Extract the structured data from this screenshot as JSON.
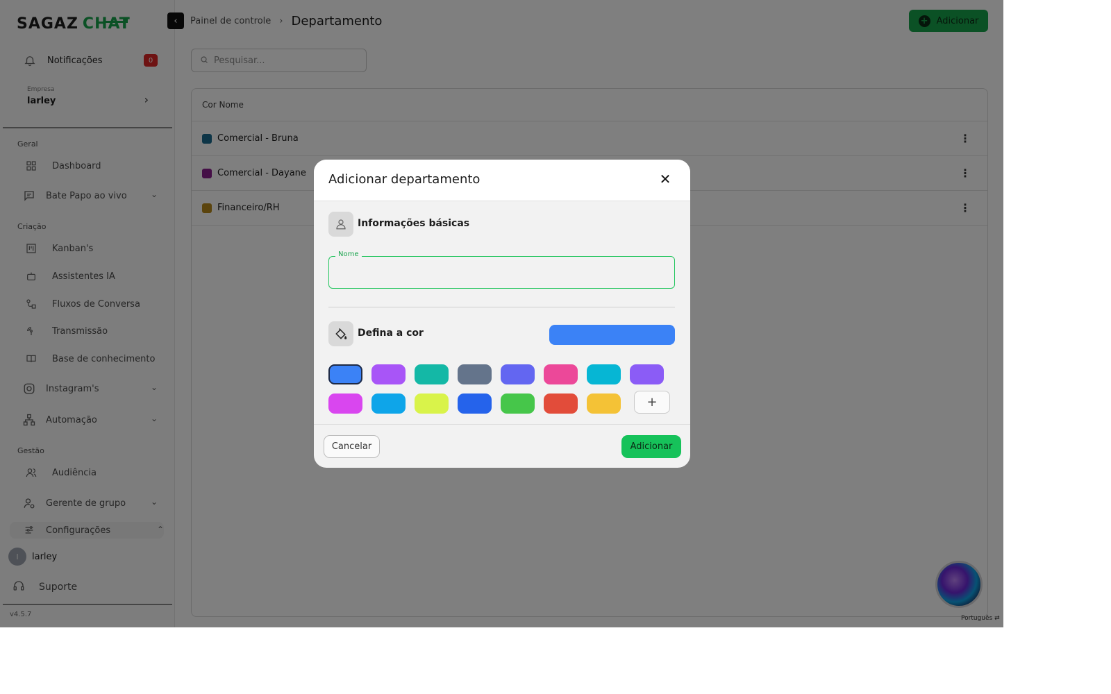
{
  "logo": {
    "part1": "SAGAZ",
    "part2": "CHAT"
  },
  "notifications": {
    "label": "Notificações",
    "count": "0"
  },
  "company": {
    "caption": "Empresa",
    "name": "larley"
  },
  "sidebar": {
    "sections": {
      "geral": "Geral",
      "criacao": "Criação",
      "gestao": "Gestão"
    },
    "items": {
      "dashboard": "Dashboard",
      "bate_papo": "Bate Papo ao vivo",
      "kanban": "Kanban's",
      "assistentes": "Assistentes IA",
      "fluxos": "Fluxos de Conversa",
      "transmissao": "Transmissão",
      "base": "Base de conhecimento",
      "instagram": "Instagram's",
      "automacao": "Automação",
      "audiencia": "Audiência",
      "gerente": "Gerente de grupo",
      "configuracoes": "Configurações"
    },
    "user": {
      "initial": "l",
      "name": "larley"
    },
    "support": "Suporte",
    "version": "v4.5.7"
  },
  "breadcrumb": {
    "parent": "Painel de controle",
    "current": "Departamento"
  },
  "header": {
    "add_label": "Adicionar"
  },
  "search": {
    "placeholder": "Pesquisar..."
  },
  "table": {
    "header": "Cor Nome",
    "rows": [
      {
        "name": "Comercial - Bruna",
        "color": "#1a6b8f"
      },
      {
        "name": "Comercial - Dayane",
        "color": "#8b1f8f"
      },
      {
        "name": "Financeiro/RH",
        "color": "#b7891a"
      }
    ]
  },
  "language": "Português",
  "modal": {
    "title": "Adicionar departamento",
    "section_basic": "Informações básicas",
    "name_label": "Nome",
    "name_value": "",
    "section_color": "Defina a cor",
    "selected_color": "#3b82f6",
    "palette": [
      "#3b82f6",
      "#a855f7",
      "#14b8a6",
      "#64748b",
      "#6366f1",
      "#ec4899",
      "#06b6d4",
      "#8b5cf6",
      "#d946ef",
      "#0ea5e9",
      "#d9f34a",
      "#2563eb",
      "#46c64a",
      "#e24c3a",
      "#f4c236"
    ],
    "cancel_label": "Cancelar",
    "submit_label": "Adicionar"
  }
}
